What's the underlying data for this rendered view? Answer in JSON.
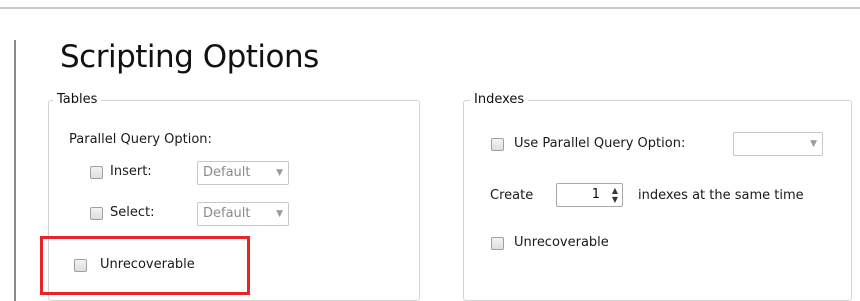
{
  "page": {
    "title": "Scripting Options"
  },
  "tables": {
    "legend": "Tables",
    "parallel_label": "Parallel Query Option:",
    "insert": {
      "label": "Insert:",
      "value": "Default",
      "checked": false
    },
    "select": {
      "label": "Select:",
      "value": "Default",
      "checked": false
    },
    "unrecoverable": {
      "label": "Unrecoverable",
      "checked": false
    }
  },
  "indexes": {
    "legend": "Indexes",
    "use_parallel": {
      "label": "Use Parallel Query Option:",
      "value": "",
      "checked": false
    },
    "create_label": "Create",
    "create_count": "1",
    "same_time_label": "indexes at the same time",
    "unrecoverable": {
      "label": "Unrecoverable",
      "checked": false
    }
  },
  "icons": {
    "dropdown": "chevron-down-icon",
    "spinner_up": "spin-up-icon",
    "spinner_down": "spin-down-icon"
  },
  "colors": {
    "highlight": "#e8242b"
  }
}
